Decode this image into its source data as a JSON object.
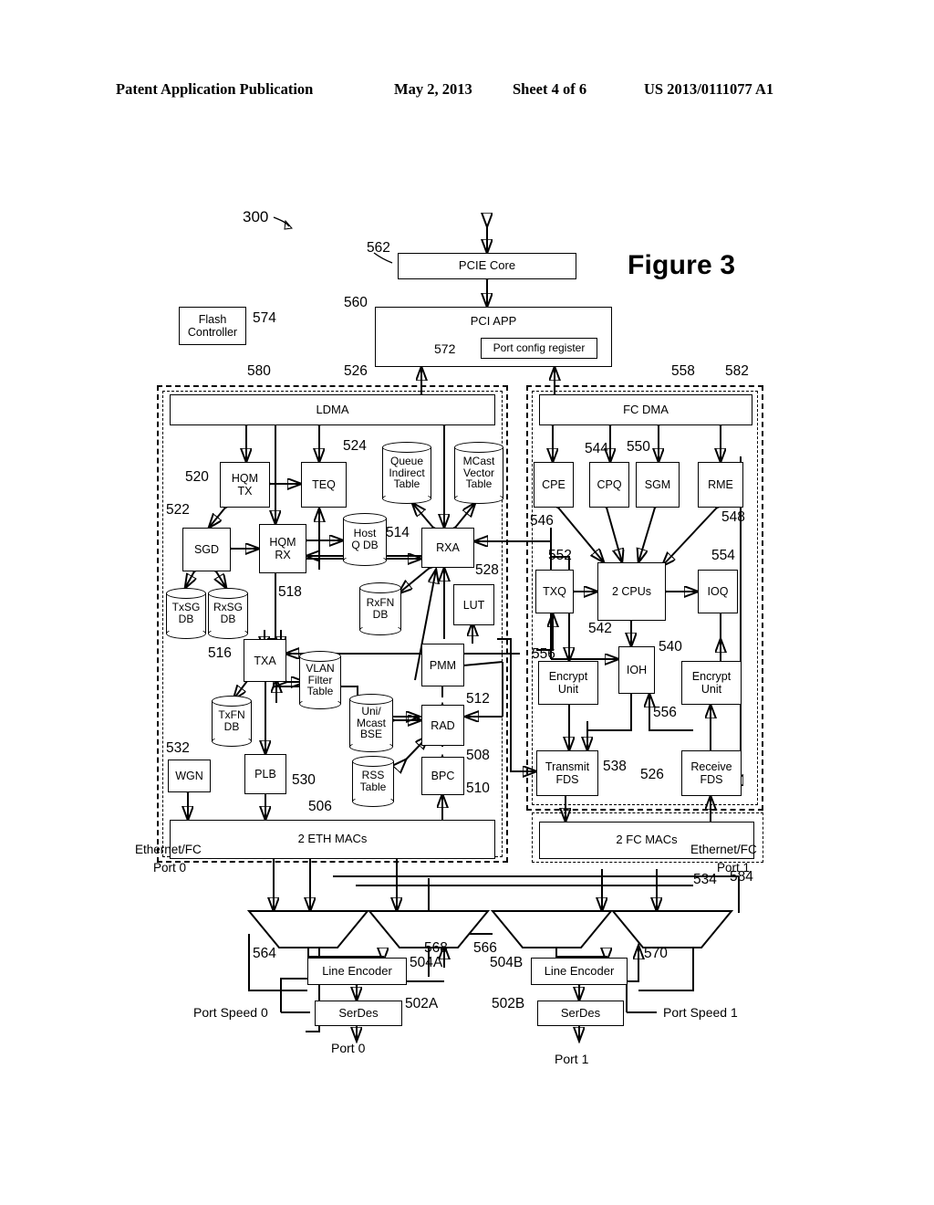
{
  "header": {
    "publication": "Patent Application Publication",
    "date": "May 2, 2013",
    "sheet": "Sheet 4 of 6",
    "number": "US 2013/0111077 A1"
  },
  "figure": {
    "title": "Figure 3",
    "system_ref": "300"
  },
  "top": {
    "pcie_core": {
      "label": "PCIE Core",
      "ref": "562"
    },
    "pci_app": {
      "label": "PCI APP",
      "ref": "560"
    },
    "port_config_register": {
      "label": "Port config register",
      "ref": "572"
    },
    "flash_controller": {
      "label": "Flash\nController",
      "line1": "Flash",
      "line2": "Controller",
      "ref": "574"
    }
  },
  "left_group": {
    "ref_outer": "580",
    "ref_inner": "526",
    "dma": {
      "label": "LDMA"
    },
    "port_label_line1": "Ethernet/FC",
    "port_label_line2": "Port 0",
    "macs": {
      "label": "2 ETH  MACs",
      "ref": "506"
    },
    "blocks": [
      {
        "name": "hqm-tx",
        "line1": "HQM",
        "line2": "TX",
        "ref": "520"
      },
      {
        "name": "teq",
        "line1": "TEQ",
        "line2": "",
        "ref": "524"
      },
      {
        "name": "sgd",
        "line1": "SGD",
        "line2": "",
        "ref": "522"
      },
      {
        "name": "hqm-rx",
        "line1": "HQM",
        "line2": "RX",
        "ref": "518"
      },
      {
        "name": "rxa",
        "line1": "RXA",
        "line2": "",
        "ref": "514"
      },
      {
        "name": "lut",
        "line1": "LUT",
        "line2": "",
        "ref": "528"
      },
      {
        "name": "txa",
        "line1": "TXA",
        "line2": "",
        "ref": "516"
      },
      {
        "name": "pmm",
        "line1": "PMM",
        "line2": "",
        "ref": "512"
      },
      {
        "name": "rad",
        "line1": "RAD",
        "line2": "",
        "ref": "508"
      },
      {
        "name": "bpc",
        "line1": "BPC",
        "line2": "",
        "ref": "510"
      },
      {
        "name": "wgn",
        "line1": "WGN",
        "line2": "",
        "ref": "532"
      },
      {
        "name": "plb",
        "line1": "PLB",
        "line2": "",
        "ref": "530"
      }
    ],
    "stores": [
      {
        "name": "queue-indirect-table",
        "lines": [
          "Queue",
          "Indirect",
          "Table"
        ]
      },
      {
        "name": "mcast-vector-table",
        "lines": [
          "MCast",
          "Vector",
          "Table"
        ]
      },
      {
        "name": "host-q-db",
        "lines": [
          "Host",
          "Q DB"
        ]
      },
      {
        "name": "rxfn-db",
        "lines": [
          "RxFN",
          "DB"
        ]
      },
      {
        "name": "txsg-db",
        "lines": [
          "TxSG",
          "DB"
        ]
      },
      {
        "name": "rxsg-db",
        "lines": [
          "RxSG",
          "DB"
        ]
      },
      {
        "name": "txfn-db",
        "lines": [
          "TxFN",
          "DB"
        ]
      },
      {
        "name": "vlan-filter-table",
        "lines": [
          "VLAN",
          "Filter",
          "Table"
        ]
      },
      {
        "name": "uni-mcast-bse",
        "lines": [
          "Uni/",
          "Mcast",
          "BSE"
        ]
      },
      {
        "name": "rss-table",
        "lines": [
          "RSS",
          "Table"
        ]
      }
    ]
  },
  "right_group": {
    "ref_outer": "582",
    "ref_inner": "558",
    "dma": {
      "label": "FC DMA"
    },
    "port_label_line1": "Ethernet/FC",
    "port_label_line2": "Port 1",
    "macs": {
      "label": "2 FC MACs",
      "ref_a": "534",
      "ref_b": "584"
    },
    "blocks": [
      {
        "name": "cpe",
        "label": "CPE",
        "ref": "546"
      },
      {
        "name": "cpq",
        "label": "CPQ",
        "ref": "544"
      },
      {
        "name": "sgm",
        "label": "SGM",
        "ref": "550"
      },
      {
        "name": "rme",
        "label": "RME",
        "ref": "548"
      },
      {
        "name": "txq",
        "label": "TXQ",
        "ref": "552"
      },
      {
        "name": "cpus",
        "label": "2 CPUs",
        "ref": "542"
      },
      {
        "name": "ioq",
        "label": "IOQ",
        "ref": "554"
      },
      {
        "name": "ioh",
        "label": "IOH",
        "ref": "540"
      },
      {
        "name": "encrypt-unit-tx",
        "line1": "Encrypt",
        "line2": "Unit",
        "ref": "556"
      },
      {
        "name": "encrypt-unit-rx",
        "line1": "Encrypt",
        "line2": "Unit",
        "ref": "556"
      },
      {
        "name": "transmit-fds",
        "line1": "Transmit",
        "line2": "FDS",
        "ref": "538"
      },
      {
        "name": "receive-fds",
        "line1": "Receive",
        "line2": "FDS",
        "ref": "526"
      }
    ]
  },
  "bottom": {
    "muxes": [
      {
        "name": "mux-564",
        "ref": "564"
      },
      {
        "name": "mux-568",
        "ref": "568"
      },
      {
        "name": "mux-566",
        "ref": "566"
      },
      {
        "name": "mux-570",
        "ref": "570"
      }
    ],
    "port0": {
      "line_encoder": {
        "label": "Line Encoder",
        "ref": "504A"
      },
      "serdes": {
        "label": "SerDes",
        "ref": "502A"
      },
      "port_speed": "Port Speed 0",
      "port": "Port 0"
    },
    "port1": {
      "line_encoder": {
        "label": "Line Encoder",
        "ref": "504B"
      },
      "serdes": {
        "label": "SerDes",
        "ref": "502B"
      },
      "port_speed": "Port Speed 1",
      "port": "Port 1"
    }
  }
}
